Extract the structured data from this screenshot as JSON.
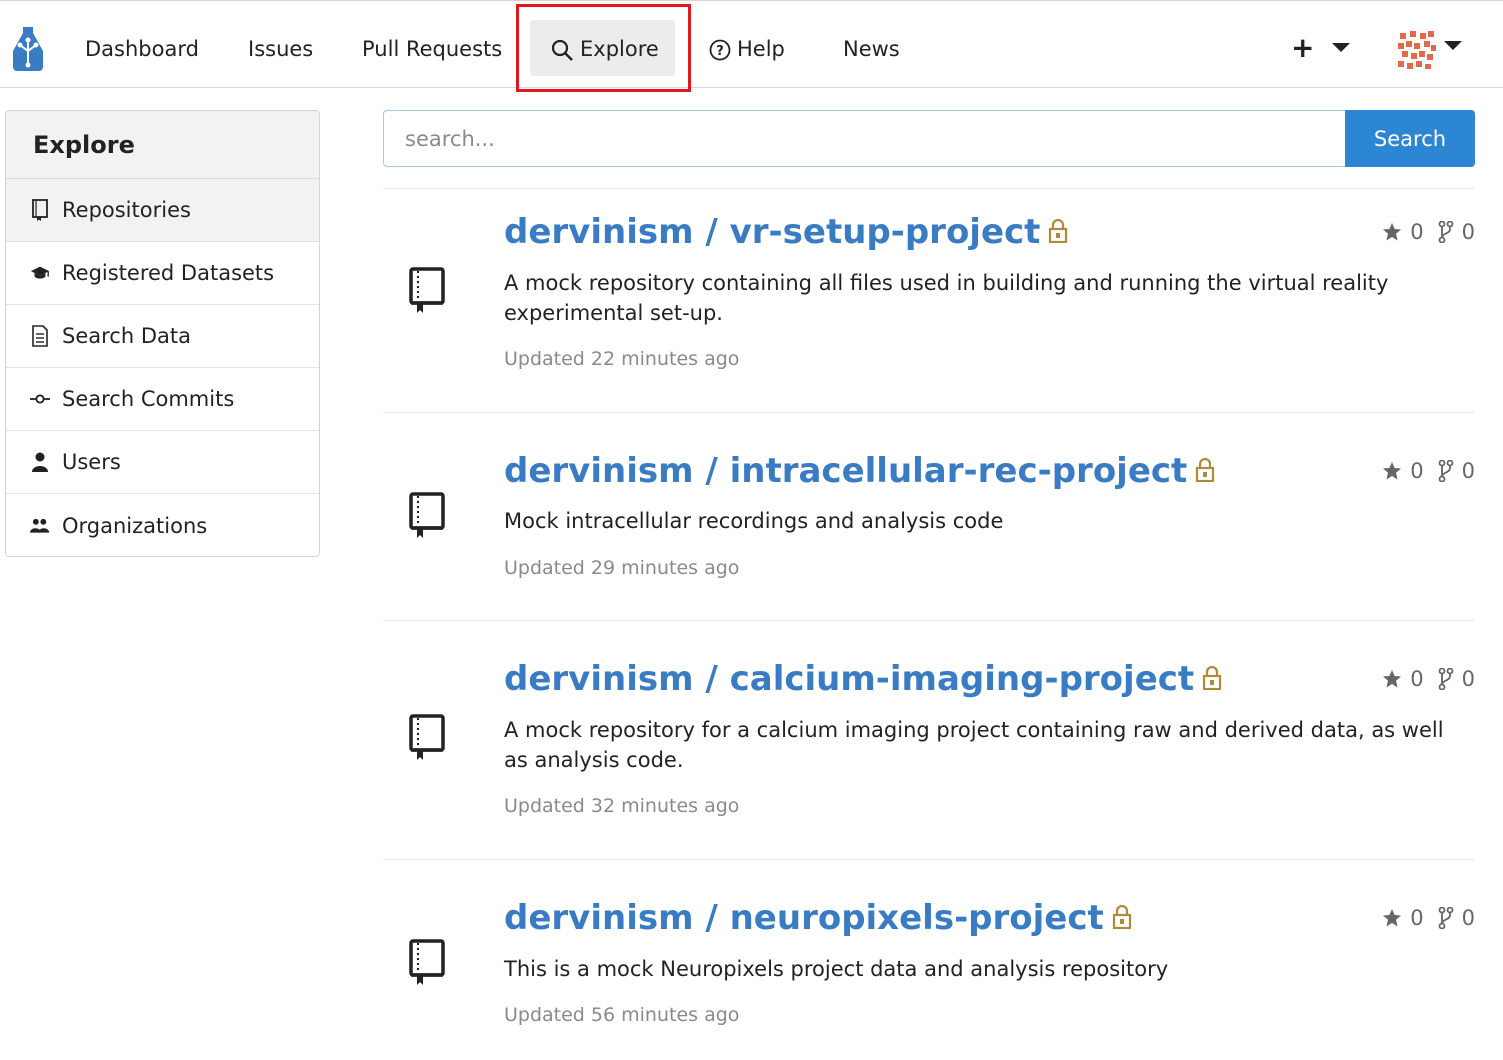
{
  "nav": {
    "items": [
      "Dashboard",
      "Issues",
      "Pull Requests",
      "Explore",
      "Help",
      "News"
    ]
  },
  "colors": {
    "link_blue": "#3a7cc4",
    "button_blue": "#2d86d3",
    "lock_gold": "#b08a36",
    "highlight_red": "#e0191e"
  },
  "sidebar": {
    "header": "Explore",
    "items": [
      {
        "label": "Repositories",
        "icon": "book-icon",
        "active": true
      },
      {
        "label": "Registered Datasets",
        "icon": "graduation-cap-icon",
        "active": false
      },
      {
        "label": "Search Data",
        "icon": "file-text-icon",
        "active": false
      },
      {
        "label": "Search Commits",
        "icon": "commit-icon",
        "active": false
      },
      {
        "label": "Users",
        "icon": "user-icon",
        "active": false
      },
      {
        "label": "Organizations",
        "icon": "users-icon",
        "active": false
      }
    ]
  },
  "search": {
    "placeholder": "search...",
    "button_label": "Search"
  },
  "repos": [
    {
      "title": "dervinism / vr-setup-project",
      "description": "A mock repository containing all files used in building and running the virtual reality experimental set-up.",
      "updated": "Updated 22 minutes ago",
      "stars": "0",
      "forks": "0"
    },
    {
      "title": "dervinism / intracellular-rec-project",
      "description": "Mock intracellular recordings and analysis code",
      "updated": "Updated 29 minutes ago",
      "stars": "0",
      "forks": "0"
    },
    {
      "title": "dervinism / calcium-imaging-project",
      "description": "A mock repository for a calcium imaging project containing raw and derived data, as well as analysis code.",
      "updated": "Updated 32 minutes ago",
      "stars": "0",
      "forks": "0"
    },
    {
      "title": "dervinism / neuropixels-project",
      "description": "This is a mock Neuropixels project data and analysis repository",
      "updated": "Updated 56 minutes ago",
      "stars": "0",
      "forks": "0"
    }
  ]
}
